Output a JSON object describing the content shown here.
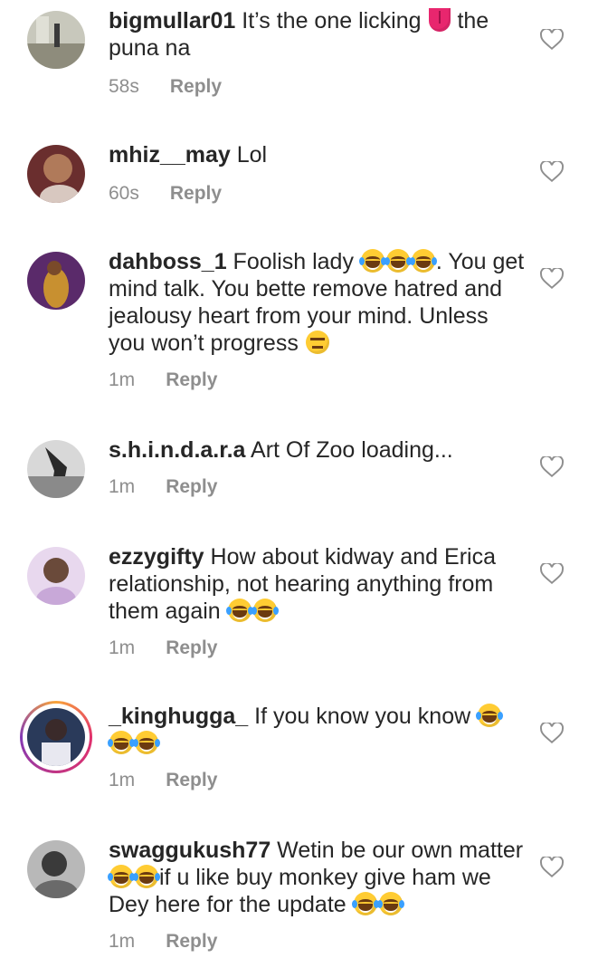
{
  "comments": [
    {
      "user": "bigmullar01",
      "pre": " It’s the one licking ",
      "post": " the puna na",
      "time": "58s",
      "reply": "Reply",
      "avatar_bg": "#8a8a7a"
    },
    {
      "user": "mhiz__may",
      "pre": " Lol",
      "post": "",
      "time": "60s",
      "reply": "Reply",
      "avatar_bg": "#7a3a3a"
    },
    {
      "user": "dahboss_1",
      "pre": " Foolish lady ",
      "post": ". You get mind talk.  You bette remove hatred and jealousy heart from your mind. Unless you won’t progress ",
      "time": "1m",
      "reply": "Reply",
      "avatar_bg": "#6a2a6a"
    },
    {
      "user": "s.h.i.n.d.a.r.a",
      "pre": " Art Of Zoo loading...",
      "post": "",
      "time": "1m",
      "reply": "Reply",
      "avatar_bg": "#9a9a9a"
    },
    {
      "user": "ezzygifty",
      "pre": " How about  kidway and Erica relationship, not hearing  anything  from them again ",
      "post": "",
      "time": "1m",
      "reply": "Reply",
      "avatar_bg": "#c9a0d8"
    },
    {
      "user": "_kinghugga_",
      "pre": " If you know you know ",
      "post": "",
      "time": "1m",
      "reply": "Reply",
      "avatar_bg": "#3a4a6a"
    },
    {
      "user": "swaggukush77",
      "pre": " Wetin be our own matter ",
      "mid": "if u like buy monkey give ham we Dey here for the update ",
      "time": "1m",
      "reply": "Reply",
      "avatar_bg": "#8a8a8a"
    }
  ],
  "icons": {
    "like": "heart-outline-icon",
    "laugh": "laughing-tears-emoji",
    "tongue": "tongue-emoji",
    "expressionless": "expressionless-emoji"
  },
  "colors": {
    "text": "#262626",
    "meta": "#8e8e8e",
    "heart": "#8e8e8e"
  }
}
